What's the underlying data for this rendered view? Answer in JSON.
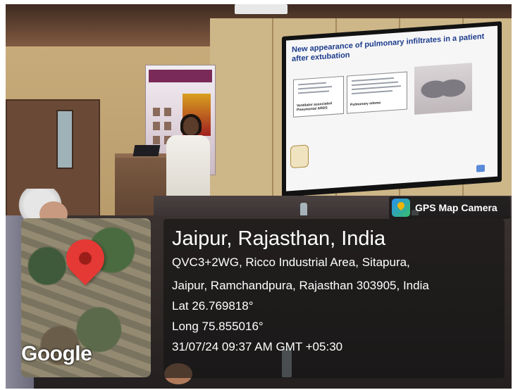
{
  "slide": {
    "title": "New appearance of pulmonary infiltrates in a patient after extubation",
    "box1_caption": "Ventilator associated Pneumonia/ ARDS",
    "box2_caption": "Pulmonary edema"
  },
  "gps_badge": {
    "label": "GPS Map Camera",
    "icon": "gps-map-camera-app-icon"
  },
  "map": {
    "logo": "Google",
    "pin_icon": "map-pin-icon",
    "pin_color": "#e53935"
  },
  "location": {
    "title": "Jaipur, Rajasthan, India",
    "address_line_1": "QVC3+2WG, Ricco Industrial Area, Sitapura,",
    "address_line_2": "Jaipur, Ramchandpura, Rajasthan 303905, India",
    "latitude": "Lat 26.769818°",
    "longitude": "Long 75.855016°",
    "datetime": "31/07/24 09:37 AM GMT +05:30"
  }
}
